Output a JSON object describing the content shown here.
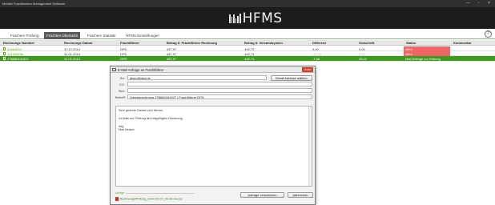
{
  "window": {
    "title": "Medikit Frachtkosten Management Software",
    "controls": [
      "—",
      "▫",
      "×"
    ]
  },
  "app": {
    "logo_text": "HFMS"
  },
  "tabs": [
    {
      "label": "Frachten Prüfung",
      "active": false
    },
    {
      "label": "Frachten Übersicht",
      "active": true
    },
    {
      "label": "Frachten Statistik",
      "active": false
    },
    {
      "label": "HFMS Einstellungen",
      "active": false
    }
  ],
  "help": "?",
  "table": {
    "columns": [
      "Rechnungs Nummer",
      "Rechnungs Datum",
      "Frachtführer",
      "Betrag lt. Frachtführer Rechnung",
      "Betrag lt. Versandsystem",
      "Differenz",
      "Gutschrift",
      "Status",
      "Kommentar"
    ],
    "rows": [
      {
        "nummer": "53464834",
        "datum": "31.12.2013",
        "fuehrer": "DPD",
        "betrag_rechnung": "487,97",
        "betrag_versand": "445,73",
        "differenz": "0,00",
        "gutschrift": "0,00",
        "status": "offen",
        "kommentar": ""
      },
      {
        "nummer": "241525456",
        "datum": "31.01.2014",
        "fuehrer": "DPD",
        "betrag_rechnung": "487,97",
        "betrag_versand": "445,73",
        "differenz": "-33,95",
        "gutschrift": "3,25",
        "status": "offen",
        "kommentar": ""
      },
      {
        "nummer": "278680441927",
        "datum": "31.01.2014",
        "fuehrer": "DPD",
        "betrag_rechnung": "487,97",
        "betrag_versand": "445,73",
        "differenz": "-7,98",
        "gutschrift": "25,21",
        "status": "Mail Anfrage zur Klärung",
        "kommentar": ""
      }
    ]
  },
  "dialog": {
    "title": "E-Mail Anfrage an Frachtführer",
    "close_label": "close",
    "labels": {
      "an": "An:",
      "cc": "CC:",
      "bcc": "Bcc:",
      "betreff": "Betreff:"
    },
    "fields": {
      "an": "dispo@dpd.de",
      "cc": "",
      "bcc": "",
      "betreff": "Umsatzrechnung 278680441927 / Frachtführer DPD"
    },
    "select_address_button": "Email Adresse wählen",
    "body_lines": [
      "Sehr geehrte Damen und Herren,",
      "",
      "ich bitte um Prüfung der beigefügten Rechnung.",
      "",
      "mfg",
      "Max Muster"
    ],
    "attachment_label": "Anlage",
    "attachment_file": "RechnungsPrüfung_2014-02-07_09-16-04.csv",
    "send_button": "Anfrage verschicken",
    "cancel_button": "Abbrechen"
  },
  "colors": {
    "header_bg": "#1c1c1c",
    "selected_row": "#3f9a1c",
    "status_open": "#f06666",
    "link_green": "#6aa51e",
    "close_red": "#d23b2a"
  }
}
